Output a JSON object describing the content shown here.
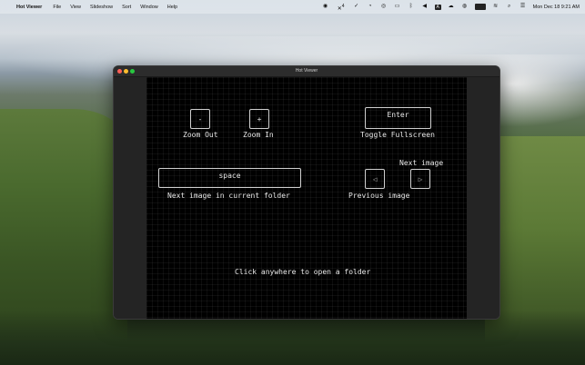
{
  "menubar": {
    "apple_icon": "apple-logo-icon",
    "app_name": "Hot Viewer",
    "items": [
      "File",
      "View",
      "Slideshow",
      "Sort",
      "Window",
      "Help"
    ],
    "status": {
      "xcode_badge": "4",
      "clock": "Mon Dec 18  9:21 AM",
      "text_input": "A"
    }
  },
  "window": {
    "title": "Hot Viewer",
    "controls": {
      "zoom_out_key": "-",
      "zoom_out_label": "Zoom Out",
      "zoom_in_key": "+",
      "zoom_in_label": "Zoom In",
      "enter_key": "Enter",
      "fullscreen_label": "Toggle Fullscreen",
      "space_key": "space",
      "next_folder_label": "Next image in current folder",
      "next_image_label": "Next image",
      "prev_key": "◁",
      "next_key": "▷",
      "prev_image_label": "Previous image"
    },
    "open_folder_prompt": "Click anywhere to open a folder"
  }
}
